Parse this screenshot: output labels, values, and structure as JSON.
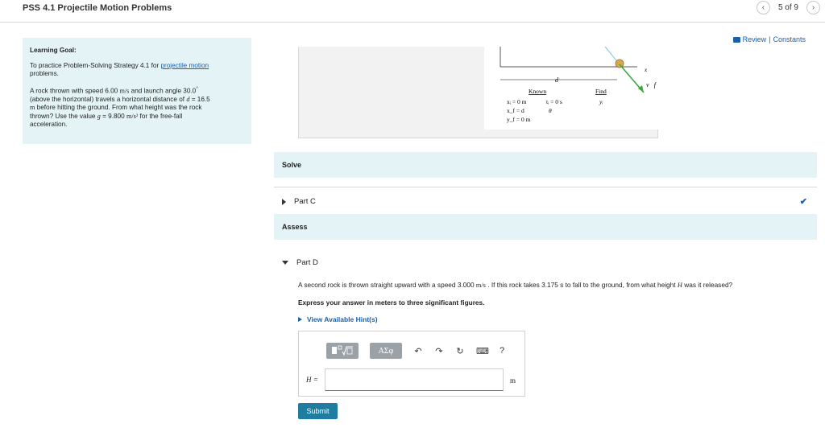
{
  "header": {
    "title": "PSS 4.1 Projectile Motion Problems",
    "prev_icon": "chevron-left-icon",
    "next_icon": "chevron-right-icon",
    "pager": "5 of 9"
  },
  "review_links": {
    "review": "Review",
    "separator": "|",
    "constants": "Constants"
  },
  "learning_goal": {
    "heading": "Learning Goal:",
    "intro_prefix": "To practice Problem-Solving Strategy 4.1 for ",
    "intro_link": "projectile motion",
    "intro_suffix": "problems.",
    "p1": "A rock thrown with speed 6.00",
    "p1_unit": "m/s",
    "p1b": " and launch angle 30.0",
    "p1_deg": "°",
    "p2": "(above the horizontal) travels a horizontal distance of",
    "p2_var": "d",
    "p2_val": " = 16.5",
    "p3_unit": "m",
    "p3": " before hitting the ground. From what height was the rock",
    "p4": "thrown? Use the value",
    "p4_var": "g",
    "p4_val": " = 9.800",
    "p4_unit": "m/s²",
    "p4b": " for the free-fall",
    "p5": "acceleration."
  },
  "figure": {
    "known_label": "Known",
    "find_label": "Find",
    "k1": "xᵢ = 0 m",
    "k2": "tᵢ = 0 s",
    "k3": "x_f = d",
    "k4": "θ",
    "k5": "y_f = 0 m",
    "f1": "yᵢ",
    "d_label": "d",
    "x_label": "x",
    "v_label": "v⃗f"
  },
  "sections": {
    "solve": "Solve",
    "part_c": "Part C",
    "assess": "Assess",
    "part_d": "Part D"
  },
  "part_d": {
    "question_a": "A second rock is thrown straight upward with a speed 3.000",
    "question_unit": "m/s",
    "question_b": ". If this rock takes 3.175 s to fall to the ground, from what height",
    "question_var": "H",
    "question_c": "was it released?",
    "instruction": "Express your answer in meters to three significant figures.",
    "hints": "View Available Hint(s)",
    "answer_label": "H =",
    "answer_value": "",
    "unit": "m",
    "submit": "Submit"
  },
  "toolbar": {
    "greek": "ΑΣφ",
    "help": "?"
  },
  "colors": {
    "accent": "#1a5fa8",
    "band": "#e4f4f6",
    "submit": "#1f7da0"
  }
}
